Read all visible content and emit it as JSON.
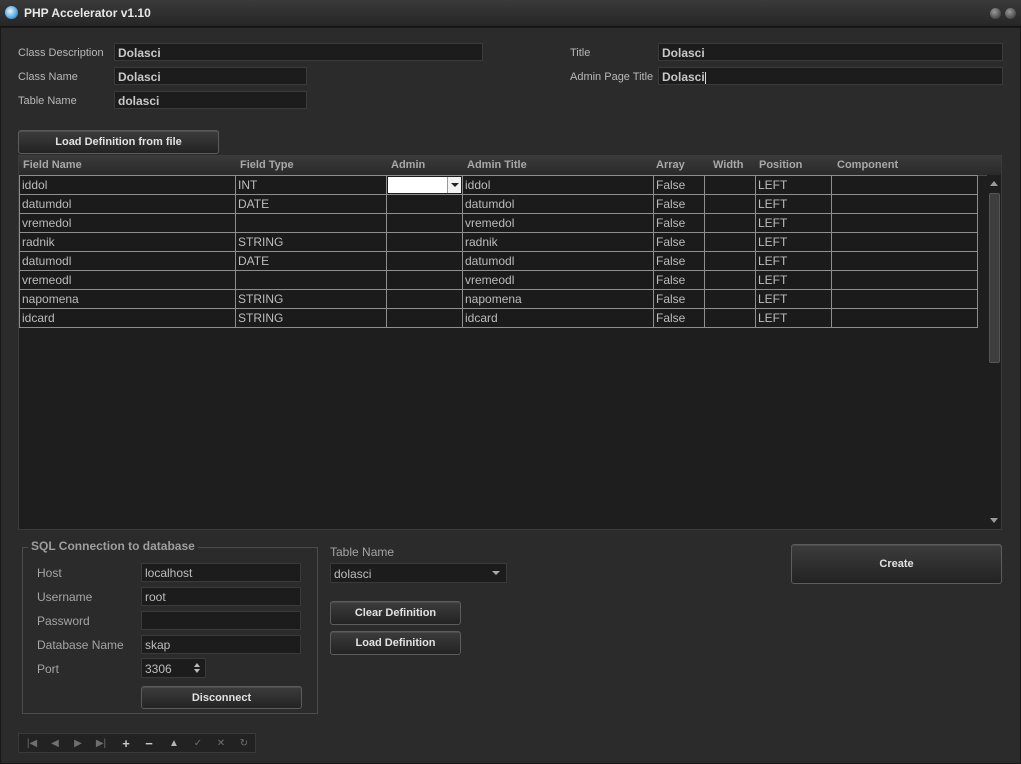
{
  "window": {
    "title": "PHP Accelerator v1.10"
  },
  "form": {
    "class_description_label": "Class Description",
    "class_description": "Dolasci",
    "class_name_label": "Class Name",
    "class_name": "Dolasci",
    "table_name_label": "Table Name",
    "table_name": "dolasci",
    "title_label": "Title",
    "title": "Dolasci",
    "admin_page_title_label": "Admin Page Title",
    "admin_page_title": "Dolasci"
  },
  "load_file_button": "Load Definition from file",
  "grid": {
    "columns": [
      "Field Name",
      "Field Type",
      "Admin",
      "Admin Title",
      "Array",
      "Width",
      "Position",
      "Component"
    ],
    "rows": [
      [
        "iddol",
        "INT",
        "",
        "iddol",
        "False",
        "",
        "LEFT",
        ""
      ],
      [
        "datumdol",
        "DATE",
        "",
        "datumdol",
        "False",
        "",
        "LEFT",
        ""
      ],
      [
        "vremedol",
        "",
        "",
        "vremedol",
        "False",
        "",
        "LEFT",
        ""
      ],
      [
        "radnik",
        "STRING",
        "",
        "radnik",
        "False",
        "",
        "LEFT",
        ""
      ],
      [
        "datumodl",
        "DATE",
        "",
        "datumodl",
        "False",
        "",
        "LEFT",
        ""
      ],
      [
        "vremeodl",
        "",
        "",
        "vremeodl",
        "False",
        "",
        "LEFT",
        ""
      ],
      [
        "napomena",
        "STRING",
        "",
        "napomena",
        "False",
        "",
        "LEFT",
        ""
      ],
      [
        "idcard",
        "STRING",
        "",
        "idcard",
        "False",
        "",
        "LEFT",
        ""
      ]
    ]
  },
  "sql": {
    "group_title": "SQL Connection to database",
    "host_label": "Host",
    "host": "localhost",
    "username_label": "Username",
    "username": "root",
    "password_label": "Password",
    "password": "",
    "database_label": "Database Name",
    "database": "skap",
    "port_label": "Port",
    "port": "3306",
    "disconnect_button": "Disconnect"
  },
  "table_select": {
    "label": "Table Name",
    "value": "dolasci"
  },
  "clear_definition_button": "Clear Definition",
  "load_definition_button": "Load Definition",
  "create_button": "Create",
  "navigator": {
    "icons": [
      "first-icon",
      "prior-icon",
      "next-icon",
      "last-icon",
      "insert-icon",
      "delete-icon",
      "edit-icon",
      "post-icon",
      "cancel-icon",
      "refresh-icon"
    ]
  }
}
